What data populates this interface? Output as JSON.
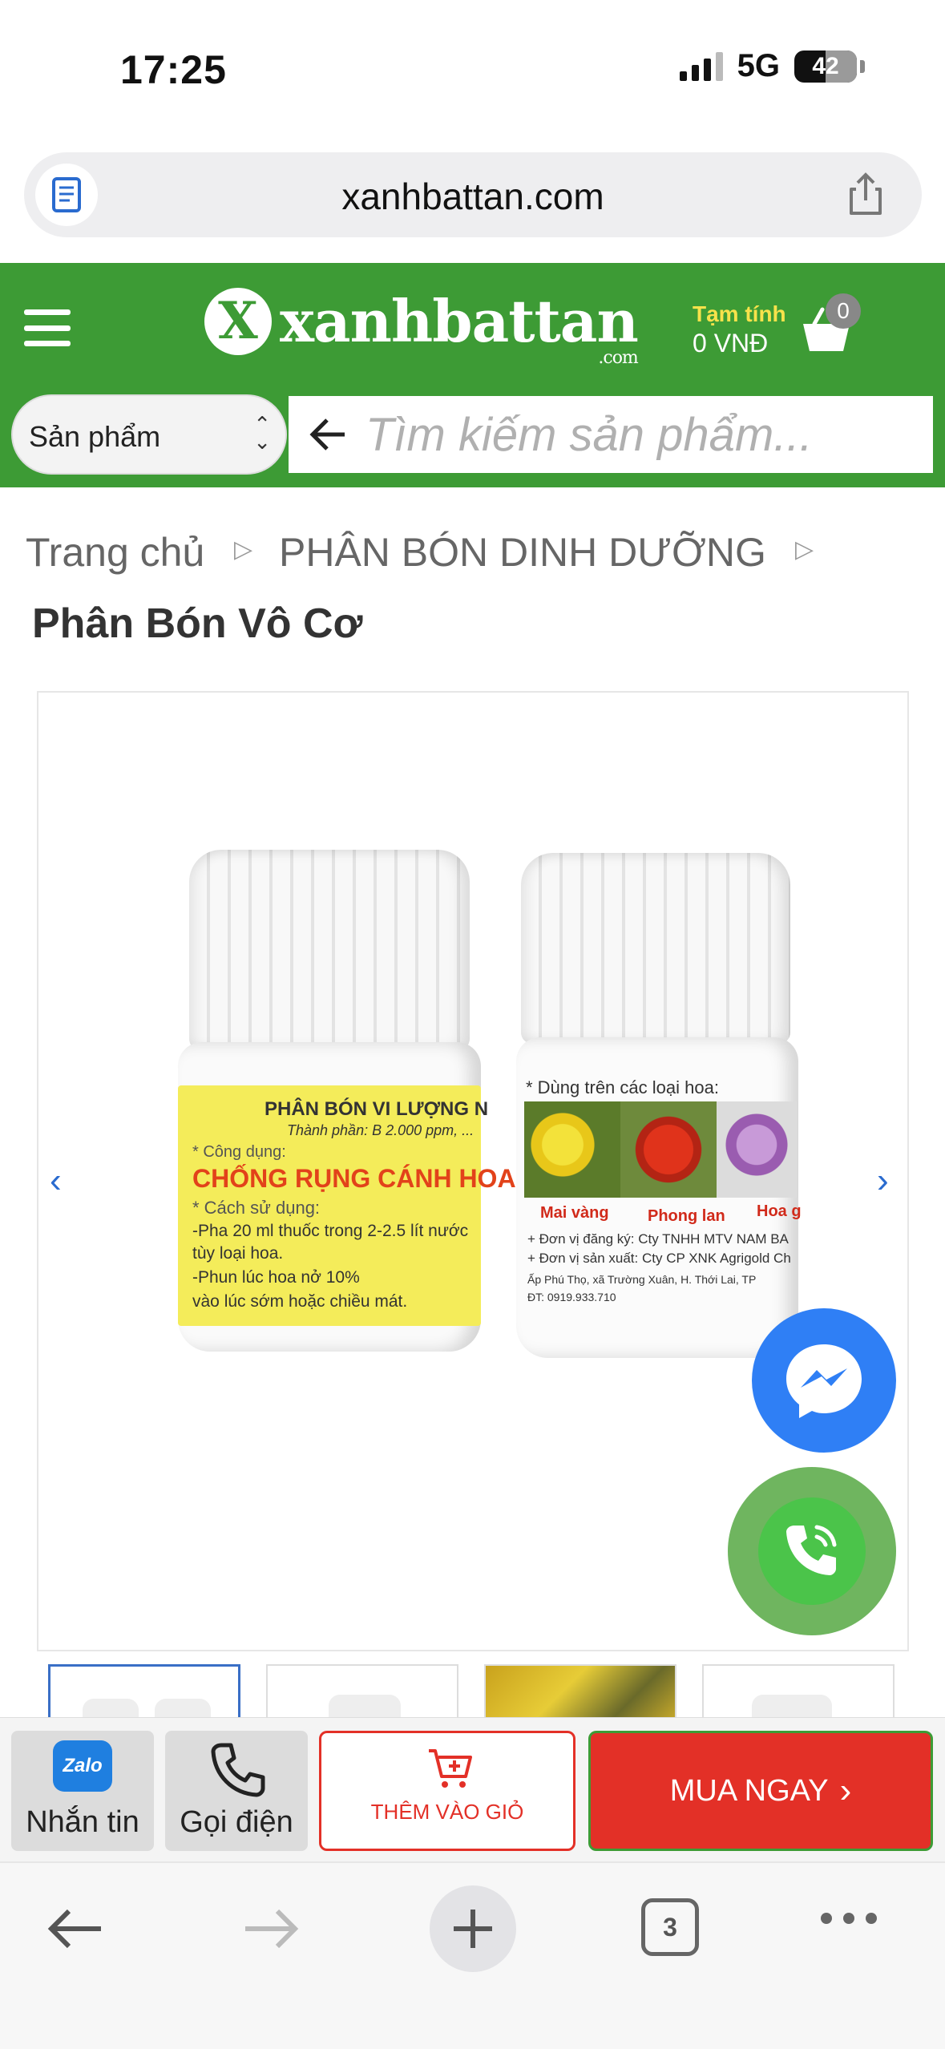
{
  "status_bar": {
    "time": "17:25",
    "network": "5G",
    "battery": "42"
  },
  "browser": {
    "url": "xanhbattan.com",
    "tab_count": "3"
  },
  "header": {
    "logo_text": "xanhbattan",
    "logo_mark": "X",
    "logo_suffix": ".com",
    "cart_label": "Tạm tính",
    "cart_total": "0 VNĐ",
    "cart_count": "0"
  },
  "search": {
    "category_selected": "Sản phẩm",
    "placeholder": "Tìm kiếm sản phẩm..."
  },
  "breadcrumb": {
    "home": "Trang chủ",
    "category": "PHÂN BÓN DINH DƯỠNG"
  },
  "page_title": "Phân Bón Vô Cơ",
  "gallery": {
    "prev": "‹",
    "next": "›",
    "thumbnail_count": 4,
    "active_thumbnail": 1
  },
  "product_image": {
    "bottle1_heading": "PHÂN BÓN VI LƯỢNG N",
    "bottle1_ingredient": "Thành phần: B 2.000 ppm, ...",
    "bottle1_use_label": "* Công dụng:",
    "bottle1_use": "CHỐNG RỤNG CÁNH HOA",
    "bottle1_howto_label": "* Cách sử dụng:",
    "bottle1_line1": "-Pha 20 ml thuốc trong 2-2.5 lít nước",
    "bottle1_line2": "tùy loại hoa.",
    "bottle1_line3": "-Phun lúc hoa nở 10%",
    "bottle1_line4": "vào lúc sớm hoặc chiều mát.",
    "bottle2_heading": "* Dùng trên các loại hoa:",
    "bottle2_flower1": "Mai vàng",
    "bottle2_flower2": "Phong lan",
    "bottle2_flower3": "Hoa g",
    "bottle2_reg": "+ Đơn vị đăng ký: Cty TNHH MTV NAM BA",
    "bottle2_mfr": "+ Đơn vị sản xuất: Cty CP XNK Agrigold Ch",
    "bottle2_addr": "Ấp Phú Thọ, xã Trường Xuân, H. Thới Lai, TP",
    "bottle2_phone": "ĐT: 0919.933.710"
  },
  "actions": {
    "zalo_logo": "Zalo",
    "zalo_label": "Nhắn tin",
    "call_label": "Gọi điện",
    "add_to_cart": "THÊM VÀO GIỎ",
    "buy_now": "MUA NGAY",
    "buy_arrow": "›"
  },
  "colors": {
    "brand_green": "#3d9b35",
    "buy_red": "#e33027",
    "messenger_blue": "#2f7ff5",
    "call_green": "#4bc44a",
    "cart_label_yellow": "#f7e24b"
  },
  "icons": [
    "reader-icon",
    "share-icon",
    "menu-icon",
    "cart-icon",
    "back-arrow-icon",
    "messenger-icon",
    "phone-icon",
    "zalo-icon",
    "add-cart-icon",
    "browser-back-icon",
    "browser-forward-icon",
    "new-tab-icon",
    "tabs-icon",
    "more-icon"
  ]
}
